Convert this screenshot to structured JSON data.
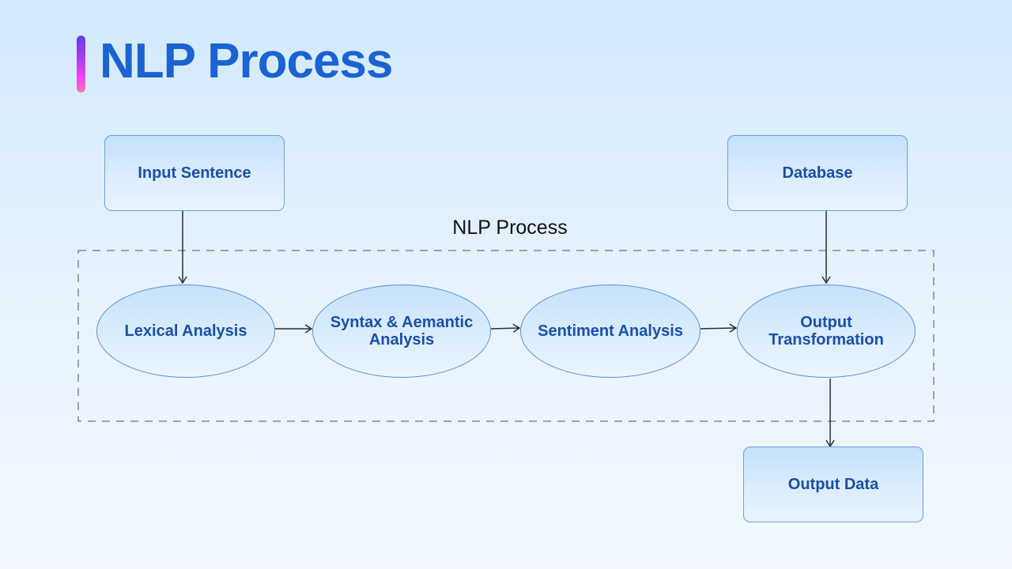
{
  "header": {
    "title": "NLP Process"
  },
  "diagram": {
    "group_label": "NLP Process",
    "nodes": {
      "input_sentence": "Input Sentence",
      "database": "Database",
      "lexical_analysis": "Lexical Analysis",
      "syntax_line1": "Syntax & Aemantic",
      "syntax_line2": "Analysis",
      "sentiment_analysis": "Sentiment Analysis",
      "output_transformation_line1": "Output",
      "output_transformation_line2": "Transformation",
      "output_data": "Output Data"
    },
    "edges": [
      {
        "from": "Input Sentence",
        "to": "Lexical Analysis"
      },
      {
        "from": "Lexical Analysis",
        "to": "Syntax & Aemantic Analysis"
      },
      {
        "from": "Syntax & Aemantic Analysis",
        "to": "Sentiment Analysis"
      },
      {
        "from": "Sentiment Analysis",
        "to": "Output Transformation"
      },
      {
        "from": "Database",
        "to": "Output Transformation"
      },
      {
        "from": "Output Transformation",
        "to": "Output Data"
      }
    ],
    "colors": {
      "title": "#1b63d2",
      "node_text": "#1a4fa8",
      "node_border": "#6e9fe0",
      "connector": "#2b2f36",
      "group_border": "#555555"
    }
  }
}
